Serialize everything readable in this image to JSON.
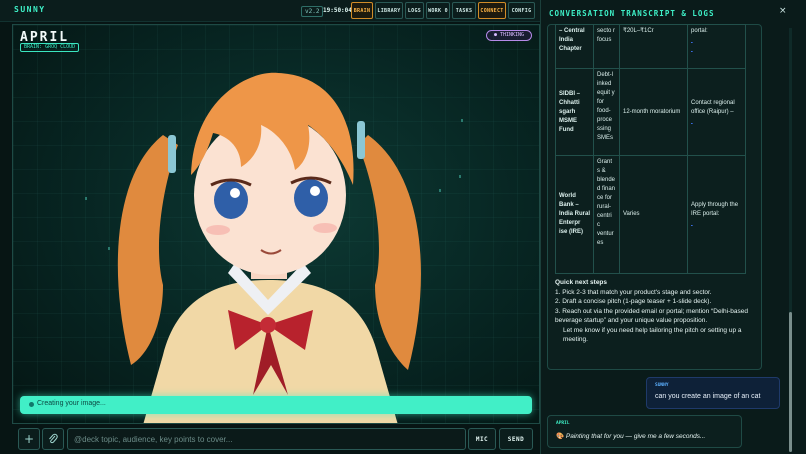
{
  "app": {
    "brand": "SUNNY",
    "version": "v2.2",
    "clock": "19:50:04"
  },
  "nav": [
    {
      "label": "BRAIN",
      "active": true
    },
    {
      "label": "LIBRARY",
      "active": false
    },
    {
      "label": "LOGS",
      "active": false
    },
    {
      "label": "WORK 0",
      "active": false
    },
    {
      "label": "TASKS",
      "active": false
    },
    {
      "label": "CONNECT",
      "active": true
    },
    {
      "label": "CONFIG",
      "active": false
    }
  ],
  "character": {
    "name": "APRIL",
    "brain": "BRAIN: GROQ CLOUD",
    "thinking": "THINKING"
  },
  "status": {
    "text": "Creating your image..."
  },
  "composer": {
    "attach_label": "+",
    "placeholder": "@deck topic, audience, key points to cover...",
    "mic_label": "MIC",
    "send_label": "SEND"
  },
  "panel": {
    "title": "CONVERSATION TRANSCRIPT & LOGS",
    "close": "×",
    "table_rows": [
      {
        "name": "– Central India Chapter",
        "desc": "secto r focus",
        "amount": "₹20L–₹1Cr",
        "contact": "portal:"
      },
      {
        "name": "SIDBI – Chhatti sgarh MSME Fund",
        "desc": "Debt-l inked equit y for food- proce ssing SMEs",
        "amount": "12-month moratorium",
        "contact": "Contact regional office (Raipur) –"
      },
      {
        "name": "World Bank – India Rural Enterpr ise (IRE)",
        "desc": "Grant s & blende d finan ce for rural- centri c ventur es",
        "amount": "Varies",
        "contact": "Apply through the IRE portal:"
      }
    ],
    "steps_heading": "Quick next steps",
    "steps": [
      "1. Pick 2-3 that match your product's stage and sector.",
      "2. Draft a concise pitch (1-page teaser + 1-slide deck).",
      "3. Reach out via the provided email or portal; mention “Delhi-based beverage startup” and your unique value proposition."
    ],
    "steps_footer": "Let me know if you need help tailoring the pitch or setting up a meeting.",
    "messages": [
      {
        "role": "SUNNY",
        "text": "can you create an image of an cat"
      },
      {
        "role": "APRIL",
        "text": "Painting that for you — give me a few seconds..."
      }
    ]
  },
  "colors": {
    "accent": "#3ef0c7",
    "warning": "#ffb545",
    "thinking": "#d8bcff"
  }
}
